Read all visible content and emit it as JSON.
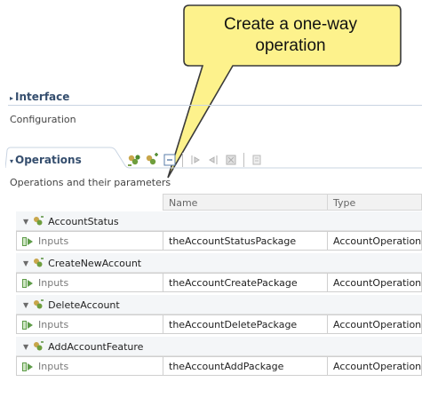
{
  "callout": {
    "text": "Create a one-way operation"
  },
  "interface_section": {
    "title": "Interface",
    "description": "Configuration"
  },
  "operations_section": {
    "title": "Operations",
    "description": "Operations and their parameters",
    "toolbar_icons": [
      "add-request-response-operation-icon",
      "add-one-way-operation-icon",
      "remove-operation-icon",
      "add-input-icon",
      "add-output-icon",
      "remove-parameter-icon",
      "add-fault-icon"
    ]
  },
  "table": {
    "columns": [
      "Name",
      "Type"
    ],
    "operations": [
      {
        "name": "AccountStatus",
        "input_label": "Inputs",
        "param_name": "theAccountStatusPackage",
        "param_type": "AccountOperation"
      },
      {
        "name": "CreateNewAccount",
        "input_label": "Inputs",
        "param_name": "theAccountCreatePackage",
        "param_type": "AccountOperation"
      },
      {
        "name": "DeleteAccount",
        "input_label": "Inputs",
        "param_name": "theAccountDeletePackage",
        "param_type": "AccountOperation"
      },
      {
        "name": "AddAccountFeature",
        "input_label": "Inputs",
        "param_name": "theAccountAddPackage",
        "param_type": "AccountOperation"
      }
    ]
  },
  "colors": {
    "section_title": "#354e6e",
    "callout_fill": "#fdf28c",
    "callout_stroke": "#3a3a3a"
  }
}
